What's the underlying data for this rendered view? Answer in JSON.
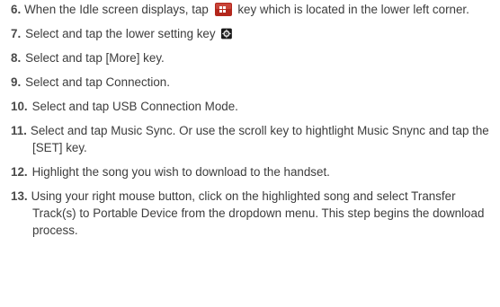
{
  "steps": [
    {
      "num": "6.",
      "before": "When the Idle screen displays, tap",
      "after": "key which is located in the lower left corner.",
      "icon": "menu-grid-icon"
    },
    {
      "num": "7.",
      "before": "Select and tap the lower setting key",
      "after": "",
      "icon": "settings-gear-icon"
    },
    {
      "num": "8.",
      "text": "Select and tap [More] key."
    },
    {
      "num": "9.",
      "text": "Select and tap Connection."
    },
    {
      "num": "10.",
      "text": "Select and tap USB Connection Mode."
    },
    {
      "num": "11.",
      "text": "Select and tap Music Sync. Or use the scroll key to hightlight Music Snync and tap the [SET] key."
    },
    {
      "num": "12.",
      "text": "Highlight the song you wish to download to the handset."
    },
    {
      "num": "13.",
      "text": "Using your right mouse button, click on the highlighted song and select Transfer Track(s) to Portable Device from the dropdown menu. This step begins the download process."
    }
  ],
  "colors": {
    "text": "#3c3c3c",
    "menu_icon_bg": "#b3271c",
    "setting_icon_bg": "#1a1a1a"
  }
}
